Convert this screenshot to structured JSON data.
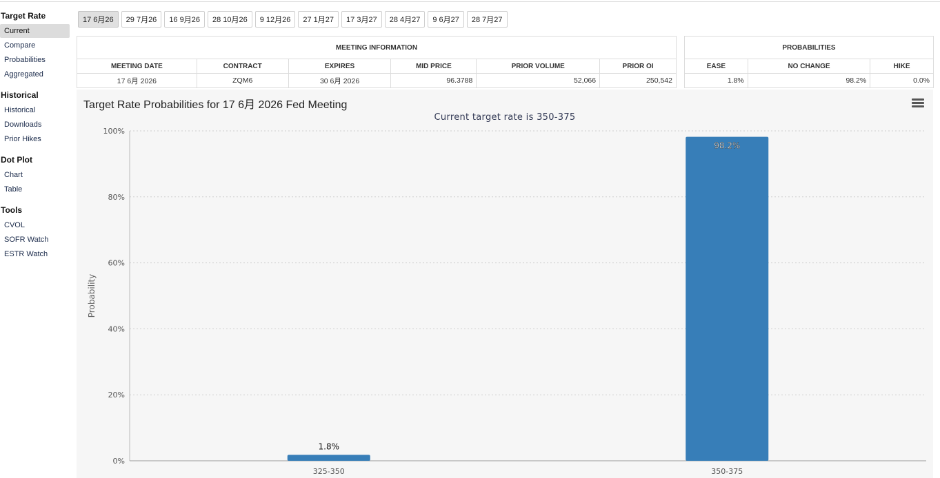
{
  "sidebar": {
    "sections": [
      {
        "title": "Target Rate",
        "items": [
          {
            "label": "Current",
            "active": true
          },
          {
            "label": "Compare",
            "active": false
          },
          {
            "label": "Probabilities",
            "active": false
          },
          {
            "label": "Aggregated",
            "active": false
          }
        ]
      },
      {
        "title": "Historical",
        "items": [
          {
            "label": "Historical",
            "active": false
          },
          {
            "label": "Downloads",
            "active": false
          },
          {
            "label": "Prior Hikes",
            "active": false
          }
        ]
      },
      {
        "title": "Dot Plot",
        "items": [
          {
            "label": "Chart",
            "active": false
          },
          {
            "label": "Table",
            "active": false
          }
        ]
      },
      {
        "title": "Tools",
        "items": [
          {
            "label": "CVOL",
            "active": false
          },
          {
            "label": "SOFR Watch",
            "active": false
          },
          {
            "label": "ESTR Watch",
            "active": false
          }
        ]
      }
    ]
  },
  "tabs": [
    {
      "label": "17 6月26",
      "active": true
    },
    {
      "label": "29 7月26",
      "active": false
    },
    {
      "label": "16 9月26",
      "active": false
    },
    {
      "label": "28 10月26",
      "active": false
    },
    {
      "label": "9 12月26",
      "active": false
    },
    {
      "label": "27 1月27",
      "active": false
    },
    {
      "label": "17 3月27",
      "active": false
    },
    {
      "label": "28 4月27",
      "active": false
    },
    {
      "label": "9 6月27",
      "active": false
    },
    {
      "label": "28 7月27",
      "active": false
    }
  ],
  "meeting_info": {
    "title": "MEETING INFORMATION",
    "headers": [
      "MEETING DATE",
      "CONTRACT",
      "EXPIRES",
      "MID PRICE",
      "PRIOR VOLUME",
      "PRIOR OI"
    ],
    "row": [
      "17 6月 2026",
      "ZQM6",
      "30 6月 2026",
      "96.3788",
      "52,066",
      "250,542"
    ]
  },
  "probabilities": {
    "title": "PROBABILITIES",
    "headers": [
      "EASE",
      "NO CHANGE",
      "HIKE"
    ],
    "row": [
      "1.8%",
      "98.2%",
      "0.0%"
    ]
  },
  "chart": {
    "title": "Target Rate Probabilities for 17 6月 2026 Fed Meeting",
    "subtitle": "Current target rate is 350-375",
    "bar_color": "#377eb8"
  },
  "chart_data": {
    "type": "bar",
    "title": "Target Rate Probabilities for 17 6月 2026 Fed Meeting",
    "subtitle": "Current target rate is 350-375",
    "categories": [
      "325-350",
      "350-375"
    ],
    "values": [
      1.8,
      98.2
    ],
    "data_labels": [
      "1.8%",
      "98.2%"
    ],
    "xlabel": "",
    "ylabel": "Probability",
    "ylim": [
      0,
      100
    ],
    "yticks": [
      "0%",
      "20%",
      "40%",
      "60%",
      "80%",
      "100%"
    ],
    "grid": true
  }
}
